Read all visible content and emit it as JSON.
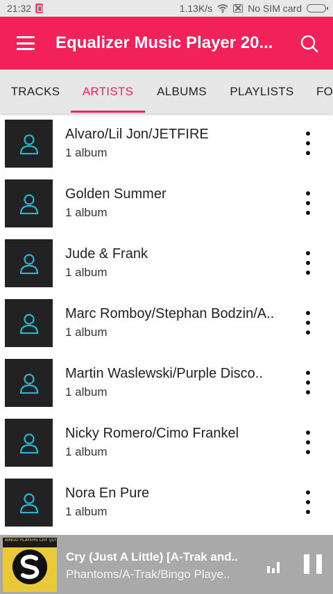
{
  "status_bar": {
    "time": "21:32",
    "net_speed": "1.13K/s",
    "carrier": "No SIM card"
  },
  "app_bar": {
    "title": "Equalizer Music Player 20...",
    "color": "#f2215a"
  },
  "tabs": [
    {
      "label": "TRACKS",
      "active": false
    },
    {
      "label": "ARTISTS",
      "active": true
    },
    {
      "label": "ALBUMS",
      "active": false
    },
    {
      "label": "PLAYLISTS",
      "active": false
    },
    {
      "label": "FO",
      "active": false
    }
  ],
  "artists": [
    {
      "name": "Alvaro/Lil Jon/JETFIRE",
      "albums": "1 album"
    },
    {
      "name": "Golden Summer",
      "albums": "1 album"
    },
    {
      "name": "Jude & Frank",
      "albums": "1 album"
    },
    {
      "name": "Marc Romboy/Stephan Bodzin/A..",
      "albums": "1 album"
    },
    {
      "name": "Martin Waslewski/Purple Disco..",
      "albums": "1 album"
    },
    {
      "name": "Nicky Romero/Cimo Frankel",
      "albums": "1 album"
    },
    {
      "name": "Nora En Pure",
      "albums": "1 album"
    }
  ],
  "now_playing": {
    "title": "Cry (Just A Little) [A-Trak and..",
    "artist": "Phantoms/A-Trak/Bingo Playe..",
    "art_text": "BINGO PLAYERS CRY (JUST A LITTLE) A-TRAK & PHANTOMS REMIX"
  },
  "icons": {
    "menu": "menu-icon",
    "search": "search-icon",
    "artist_placeholder": "person-icon",
    "more": "more-vert-icon",
    "equalizer": "equalizer-icon",
    "pause": "pause-icon"
  }
}
